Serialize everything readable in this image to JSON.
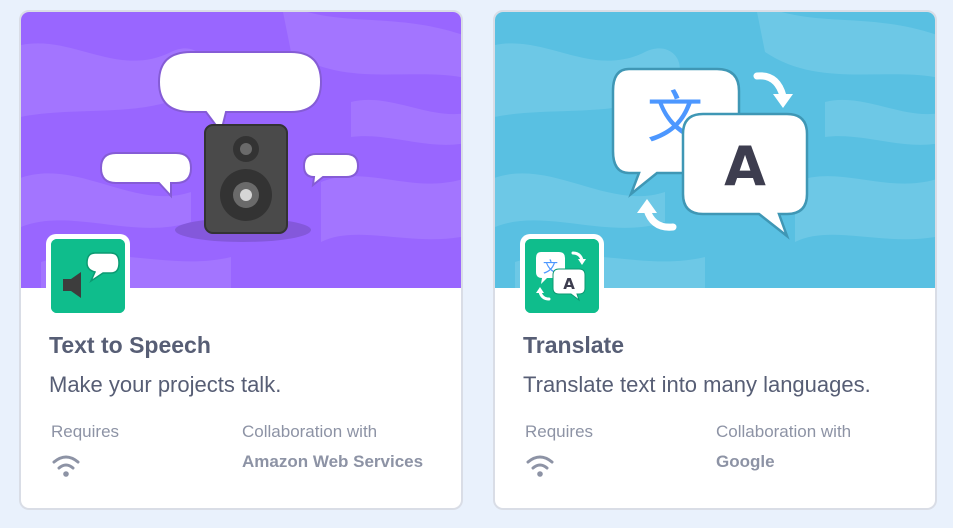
{
  "extensions": [
    {
      "title": "Text to Speech",
      "description": "Make your projects talk.",
      "requires_label": "Requires",
      "requires_icon": "wifi-icon",
      "collaboration_label": "Collaboration with",
      "collaborator": "Amazon Web Services",
      "banner_color": "#9966ff",
      "icon_color": "#0fbd8c"
    },
    {
      "title": "Translate",
      "description": "Translate text into many languages.",
      "requires_label": "Requires",
      "requires_icon": "wifi-icon",
      "collaboration_label": "Collaboration with",
      "collaborator": "Google",
      "banner_color": "#59c0e2",
      "icon_color": "#0fbd8c",
      "banner_glyph_source": "文",
      "banner_glyph_target": "A"
    }
  ]
}
